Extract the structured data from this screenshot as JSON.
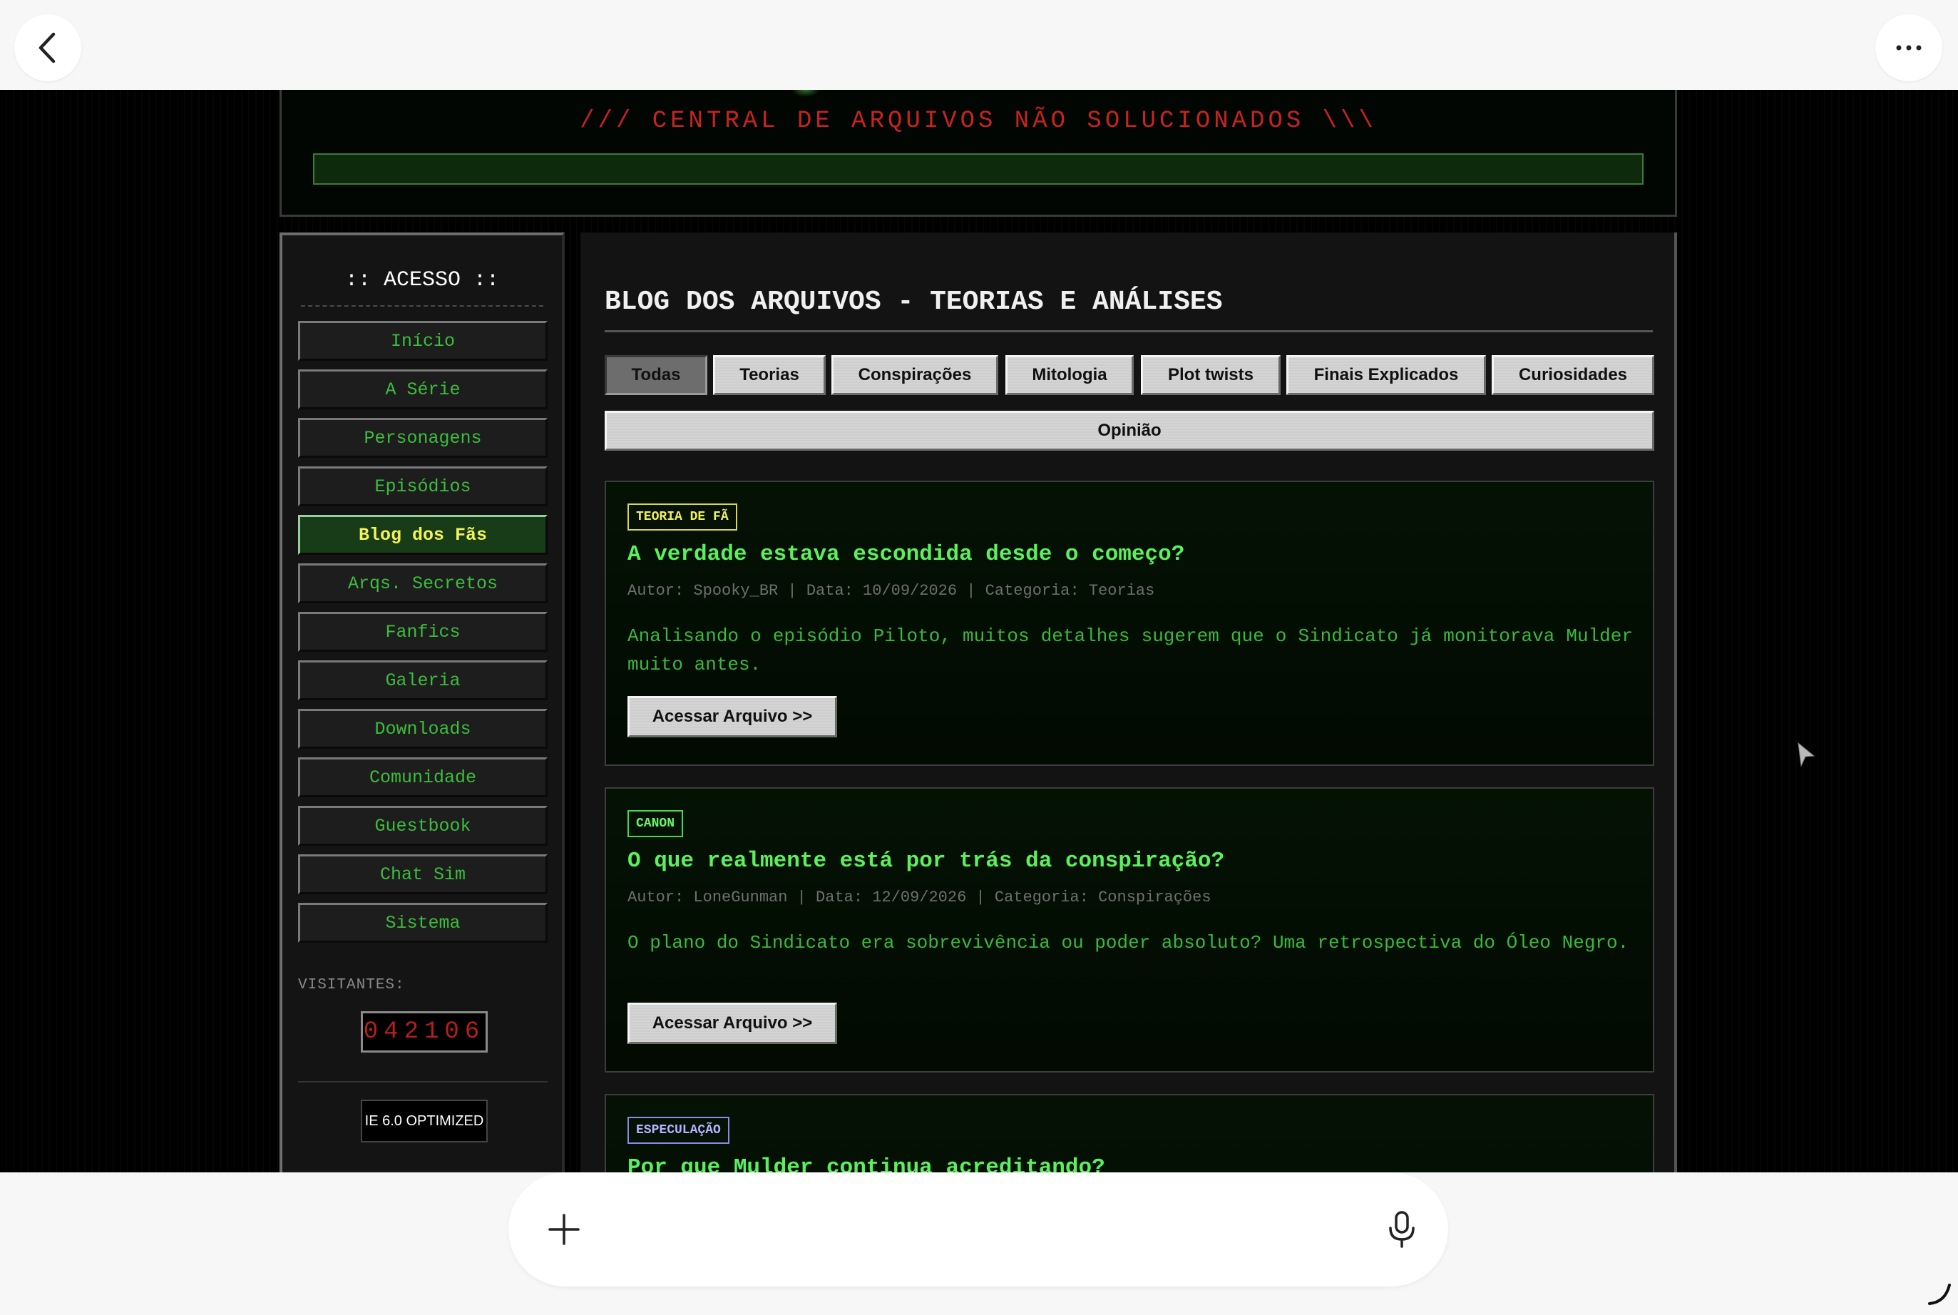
{
  "header": {
    "subtitle": "/// CENTRAL DE ARQUIVOS NÃO SOLUCIONADOS \\\\\\"
  },
  "sidebar": {
    "title": ":: ACESSO ::",
    "items": [
      {
        "label": "Início",
        "active": false
      },
      {
        "label": "A Série",
        "active": false
      },
      {
        "label": "Personagens",
        "active": false
      },
      {
        "label": "Episódios",
        "active": false
      },
      {
        "label": "Blog dos Fãs",
        "active": true
      },
      {
        "label": "Arqs. Secretos",
        "active": false
      },
      {
        "label": "Fanfics",
        "active": false
      },
      {
        "label": "Galeria",
        "active": false
      },
      {
        "label": "Downloads",
        "active": false
      },
      {
        "label": "Comunidade",
        "active": false
      },
      {
        "label": "Guestbook",
        "active": false
      },
      {
        "label": "Chat Sim",
        "active": false
      },
      {
        "label": "Sistema",
        "active": false
      }
    ],
    "visitors_label": "VISITANTES:",
    "visitors_count": "042106",
    "badge": "IE 6.0 OPTIMIZED"
  },
  "main": {
    "title": "BLOG DOS ARQUIVOS - TEORIAS E ANÁLISES",
    "filters": [
      {
        "label": "Todas",
        "active": true
      },
      {
        "label": "Teorias",
        "active": false
      },
      {
        "label": "Conspirações",
        "active": false
      },
      {
        "label": "Mitologia",
        "active": false
      },
      {
        "label": "Plot twists",
        "active": false
      },
      {
        "label": "Finais Explicados",
        "active": false
      },
      {
        "label": "Curiosidades",
        "active": false
      },
      {
        "label": "Opinião",
        "active": false
      }
    ],
    "posts": [
      {
        "tag": "TEORIA DE FÃ",
        "title": "A verdade estava escondida desde o começo?",
        "meta": "Autor: Spooky_BR | Data: 10/09/2026 | Categoria: Teorias",
        "excerpt": "Analisando o episódio Piloto, muitos detalhes sugerem que o Sindicato já monitorava Mulder muito antes.",
        "button": "Acessar Arquivo >>"
      },
      {
        "tag": "CANON",
        "title": "O que realmente está por trás da conspiração?",
        "meta": "Autor: LoneGunman | Data: 12/09/2026 | Categoria: Conspirações",
        "excerpt": "O plano do Sindicato era sobrevivência ou poder absoluto? Uma retrospectiva do Óleo Negro.",
        "button": "Acessar Arquivo >>"
      },
      {
        "tag": "ESPECULAÇÃO",
        "title": "Por que Mulder continua acreditando?"
      }
    ]
  },
  "browser": {
    "back_icon": "chevron-left-icon",
    "more_icon": "more-horizontal-icon",
    "composer_placeholder": "",
    "plus_icon": "plus-icon",
    "mic_icon": "microphone-icon"
  },
  "colors": {
    "terminal_green": "#3cbd3c",
    "title_green": "#5cf05c",
    "header_red": "#c8231f",
    "active_yellow": "#f2f25a"
  }
}
